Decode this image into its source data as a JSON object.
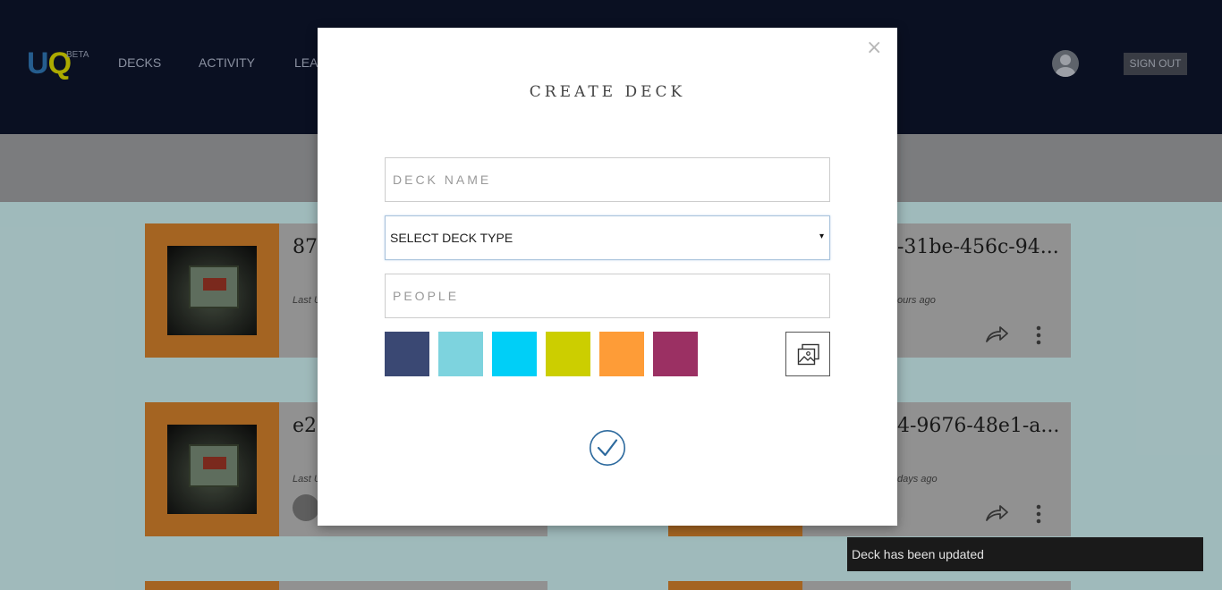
{
  "header": {
    "logo_u": "U",
    "logo_q": "Q",
    "logo_badge": "BETA",
    "nav": [
      {
        "label": "DECKS"
      },
      {
        "label": "ACTIVITY"
      },
      {
        "label": "LEAR"
      }
    ],
    "sign_out_label": "SIGN OUT"
  },
  "cards": [
    {
      "title": "87",
      "meta": "Last U"
    },
    {
      "title": "e2",
      "meta": "Last U"
    }
  ],
  "right_cards": [
    {
      "title": "-31be-456c-94...",
      "meta": "ours ago"
    },
    {
      "title": "4-9676-48e1-a...",
      "meta": "days ago"
    }
  ],
  "modal": {
    "close_label": "×",
    "title": "CREATE DECK",
    "deck_name_placeholder": "DECK NAME",
    "deck_type_label": "SELECT DECK TYPE",
    "deck_type_arrow": "▾",
    "people_placeholder": "PEOPLE",
    "colors": [
      "#3a4873",
      "#7dd3de",
      "#00cff7",
      "#ccce00",
      "#fe9c37",
      "#9b3063"
    ]
  },
  "toast": {
    "message": "Deck has been updated"
  }
}
